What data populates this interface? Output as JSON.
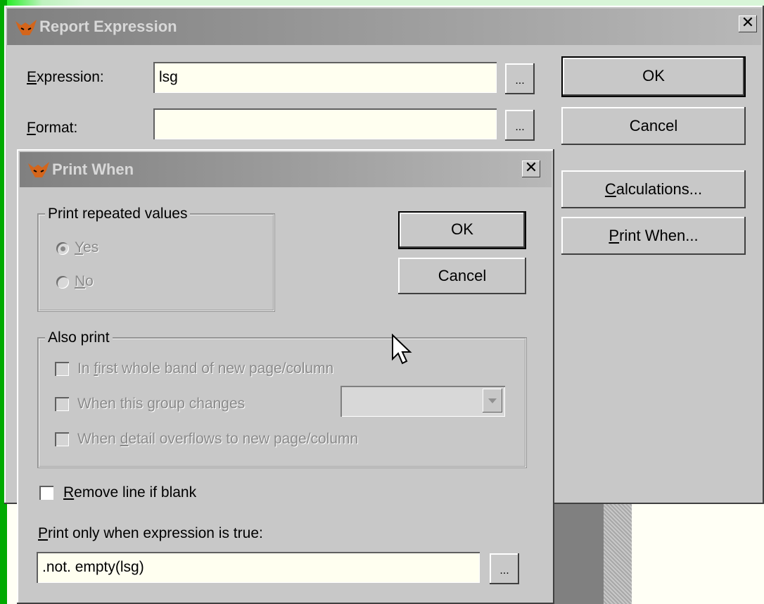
{
  "report_expression": {
    "title": "Report Expression",
    "close_glyph": "✕",
    "expression_label_key": "E",
    "expression_label_rest": "xpression:",
    "expression_value": "lsg",
    "format_label_key": "F",
    "format_label_rest": "ormat:",
    "format_value": "",
    "builder_glyph": "...",
    "ok_label": "OK",
    "cancel_label": "Cancel",
    "calculations_key": "C",
    "calculations_rest": "alculations...",
    "print_when_key": "P",
    "print_when_rest": "rint When..."
  },
  "print_when": {
    "title": "Print When",
    "close_glyph": "✕",
    "repeated_group_label": "Print repeated values",
    "yes_key": "Y",
    "yes_rest": "es",
    "no_key": "N",
    "no_rest": "o",
    "ok_label": "OK",
    "cancel_label": "Cancel",
    "also_print_label": "Also print",
    "first_band_pre": "In ",
    "first_band_key": "f",
    "first_band_rest": "irst whole band of new page/column",
    "group_changes_pre": "When this ",
    "group_changes_key": "g",
    "group_changes_rest": "roup changes",
    "group_selected": "",
    "detail_pre": "When ",
    "detail_key": "d",
    "detail_rest": "etail overflows to new page/column",
    "remove_key": "R",
    "remove_rest": "emove line if blank",
    "expr_label_key": "P",
    "expr_label_rest": "rint only when expression is true:",
    "expr_value": ".not. empty(lsg)",
    "builder_glyph": "..."
  },
  "icons": [
    "fox-icon",
    "close-icon",
    "chevron-down-icon",
    "mouse-cursor-icon"
  ]
}
